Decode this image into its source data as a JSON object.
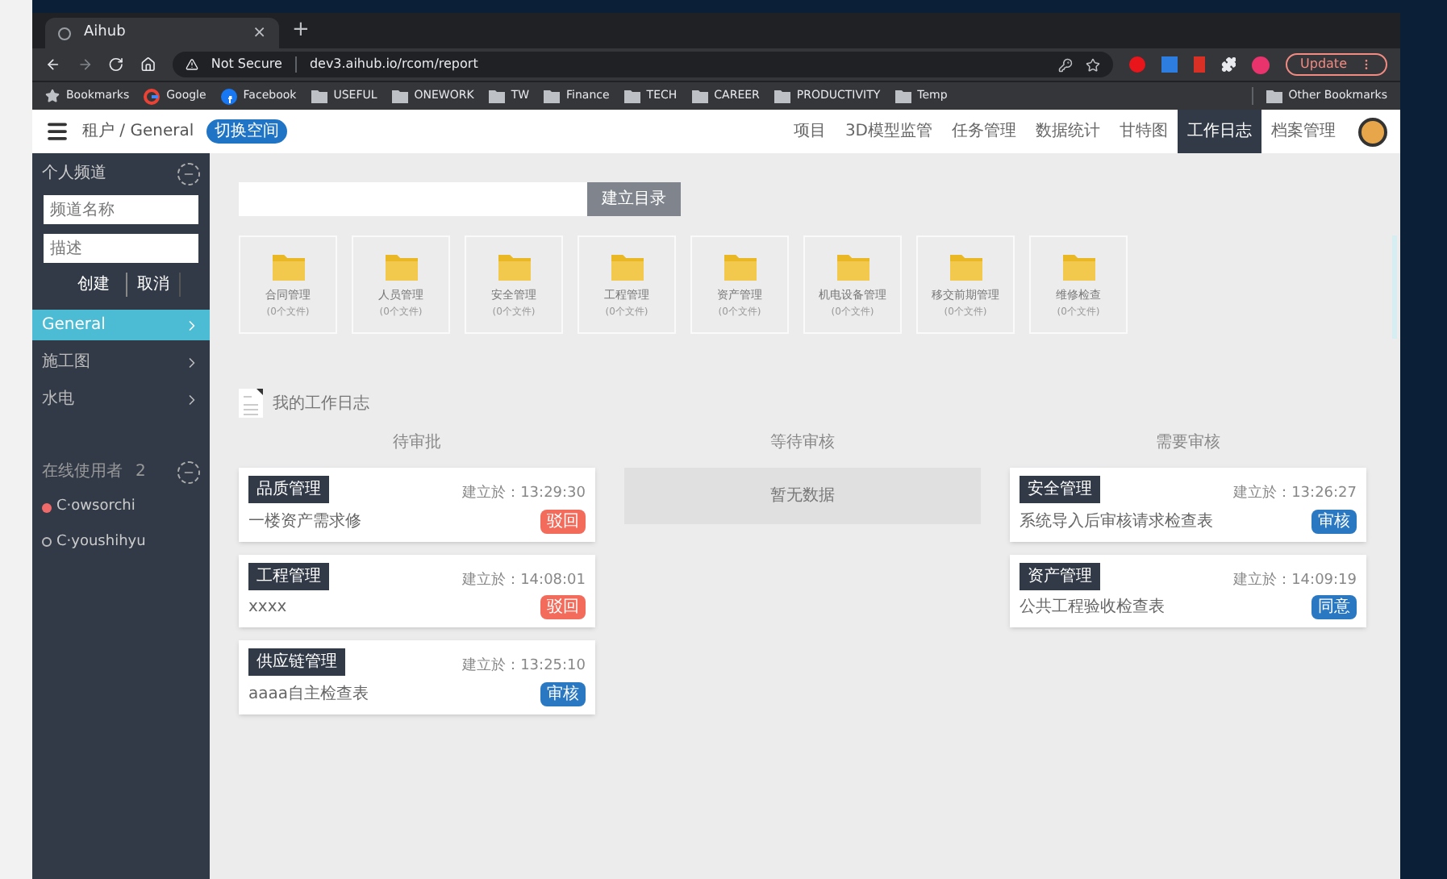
{
  "browser": {
    "tab": {
      "title": "Aihub",
      "close": "×"
    },
    "new_tab": "+",
    "security": "Not Secure",
    "url": "dev3.aihub.io/rcom/report",
    "update_button": "Update",
    "bookmarks": [
      {
        "label": "Bookmarks",
        "kind": "star"
      },
      {
        "label": "Google",
        "kind": "google"
      },
      {
        "label": "Facebook",
        "kind": "facebook"
      },
      {
        "label": "USEFUL",
        "kind": "folder"
      },
      {
        "label": "ONEWORK",
        "kind": "folder"
      },
      {
        "label": "TW",
        "kind": "folder"
      },
      {
        "label": "Finance",
        "kind": "folder"
      },
      {
        "label": "TECH",
        "kind": "folder"
      },
      {
        "label": "CAREER",
        "kind": "folder"
      },
      {
        "label": "PRODUCTIVITY",
        "kind": "folder"
      },
      {
        "label": "Temp",
        "kind": "folder"
      }
    ],
    "other_bookmarks": "Other Bookmarks"
  },
  "header": {
    "breadcrumb": "租户 / General",
    "badge": "切换空间",
    "nav": [
      {
        "label": "项目",
        "selected": false
      },
      {
        "label": "3D模型监管",
        "selected": false
      },
      {
        "label": "任务管理",
        "selected": false
      },
      {
        "label": "数据统计",
        "selected": false
      },
      {
        "label": "甘特图",
        "selected": false
      },
      {
        "label": "工作日志",
        "selected": true
      },
      {
        "label": "档案管理",
        "selected": false
      }
    ]
  },
  "sidebar": {
    "title": "个人频道",
    "name_placeholder": "频道名称",
    "desc_placeholder": "描述",
    "create": "创建",
    "cancel": "取消",
    "channels": [
      {
        "label": "General",
        "selected": true
      },
      {
        "label": "施工图",
        "selected": false
      },
      {
        "label": "水电",
        "selected": false
      }
    ],
    "online_title": "在线使用者",
    "online_count": "2",
    "users": [
      {
        "name": "C·owsorchi",
        "online": true
      },
      {
        "name": "C·youshihyu",
        "online": false
      }
    ]
  },
  "main": {
    "create_button": "建立目录",
    "folders": [
      {
        "name": "合同管理",
        "count": "(0个文件)"
      },
      {
        "name": "人员管理",
        "count": "(0个文件)"
      },
      {
        "name": "安全管理",
        "count": "(0个文件)"
      },
      {
        "name": "工程管理",
        "count": "(0个文件)"
      },
      {
        "name": "资产管理",
        "count": "(0个文件)"
      },
      {
        "name": "机电设备管理",
        "count": "(0个文件)"
      },
      {
        "name": "移交前期管理",
        "count": "(0个文件)"
      },
      {
        "name": "维修检查",
        "count": "(0个文件)"
      }
    ],
    "log_title": "我的工作日志",
    "columns": [
      {
        "title": "待审批",
        "cards": [
          {
            "tag": "品质管理",
            "time": "建立於：13:29:30",
            "desc": "一楼资产需求修",
            "status": "驳回",
            "kind": "rejected"
          },
          {
            "tag": "工程管理",
            "time": "建立於：14:08:01",
            "desc": "xxxx",
            "status": "驳回",
            "kind": "rejected"
          },
          {
            "tag": "供应链管理",
            "time": "建立於：13:25:10",
            "desc": "aaaa自主检查表",
            "status": "审核",
            "kind": "pending"
          }
        ]
      },
      {
        "title": "等待审核",
        "empty": "暂无数据"
      },
      {
        "title": "需要审核",
        "cards": [
          {
            "tag": "安全管理",
            "time": "建立於：13:26:27",
            "desc": "系统导入后审核请求检查表",
            "status": "审核",
            "kind": "pending"
          },
          {
            "tag": "资产管理",
            "time": "建立於：14:09:19",
            "desc": "公共工程验收检查表",
            "status": "同意",
            "kind": "pending"
          }
        ]
      }
    ]
  }
}
